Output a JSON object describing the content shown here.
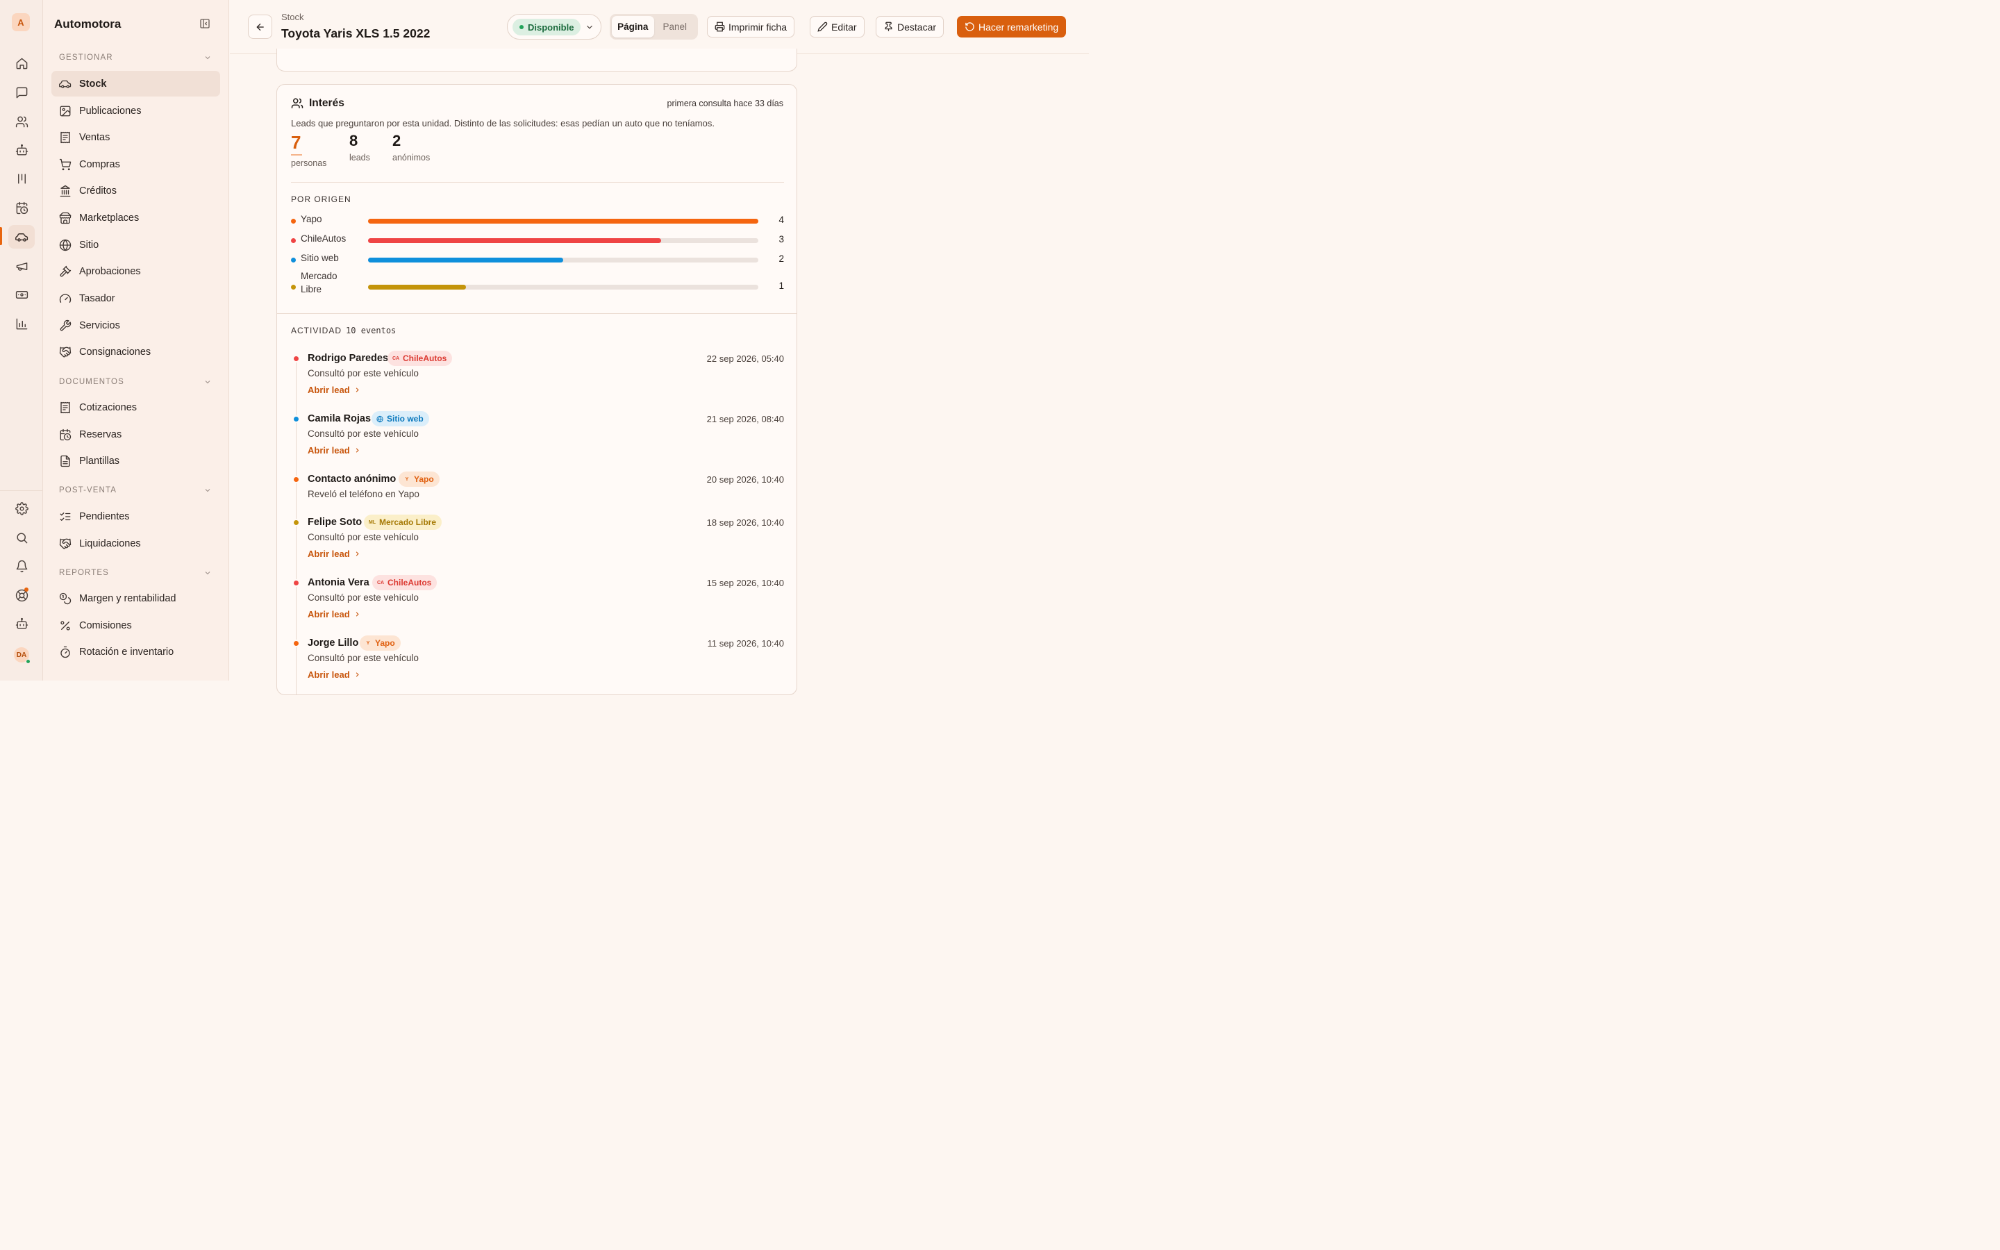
{
  "app": {
    "logo_letter": "A",
    "name": "Automotora",
    "user_initials": "DA"
  },
  "rail": {
    "top_icons": [
      "home-icon",
      "chat-icon",
      "users-icon",
      "bot-icon",
      "kanban-icon",
      "calendar-clock-icon",
      "car-icon",
      "megaphone-icon",
      "cash-icon",
      "bar-chart-icon"
    ],
    "bottom_icons": [
      "gear-icon",
      "search-icon",
      "bell-icon",
      "lifebuoy-icon",
      "bot-icon"
    ]
  },
  "sidebar": {
    "sections": [
      {
        "title": "GESTIONAR",
        "items": [
          {
            "label": "Stock",
            "icon": "car-icon",
            "active": true
          },
          {
            "label": "Publicaciones",
            "icon": "image-icon"
          },
          {
            "label": "Ventas",
            "icon": "receipt-icon"
          },
          {
            "label": "Compras",
            "icon": "cart-icon"
          },
          {
            "label": "Créditos",
            "icon": "bank-icon"
          },
          {
            "label": "Marketplaces",
            "icon": "store-icon"
          },
          {
            "label": "Sitio",
            "icon": "globe-icon"
          },
          {
            "label": "Aprobaciones",
            "icon": "gavel-icon"
          },
          {
            "label": "Tasador",
            "icon": "gauge-icon"
          },
          {
            "label": "Servicios",
            "icon": "wrench-icon"
          },
          {
            "label": "Consignaciones",
            "icon": "handshake-icon"
          }
        ]
      },
      {
        "title": "DOCUMENTOS",
        "items": [
          {
            "label": "Cotizaciones",
            "icon": "receipt-icon"
          },
          {
            "label": "Reservas",
            "icon": "calendar-clock-icon"
          },
          {
            "label": "Plantillas",
            "icon": "file-text-icon"
          }
        ]
      },
      {
        "title": "POST-VENTA",
        "items": [
          {
            "label": "Pendientes",
            "icon": "list-checks-icon"
          },
          {
            "label": "Liquidaciones",
            "icon": "handshake-icon"
          }
        ]
      },
      {
        "title": "REPORTES",
        "items": [
          {
            "label": "Margen y rentabilidad",
            "icon": "coins-icon"
          },
          {
            "label": "Comisiones",
            "icon": "percent-icon"
          },
          {
            "label": "Rotación e inventario",
            "icon": "timer-icon"
          }
        ]
      }
    ]
  },
  "header": {
    "breadcrumb": "Stock",
    "title": "Toyota Yaris XLS 1.5 2022",
    "status": "Disponible",
    "view_options": [
      "Página",
      "Panel"
    ],
    "view_selected": "Página",
    "buttons": {
      "print": "Imprimir ficha",
      "edit": "Editar",
      "feature": "Destacar",
      "remarketing": "Hacer remarketing"
    }
  },
  "interest": {
    "title": "Interés",
    "meta": "primera consulta hace 33 días",
    "description": "Leads que preguntaron por esta unidad. Distinto de las solicitudes: esas pedían un auto que no teníamos.",
    "stats": [
      {
        "value": "7",
        "label": "personas"
      },
      {
        "value": "8",
        "label": "leads"
      },
      {
        "value": "2",
        "label": "anónimos"
      }
    ],
    "origin_title": "POR ORIGEN",
    "origin_max": 4,
    "origins": [
      {
        "name": "Yapo",
        "count": 4,
        "color": "#f5650f"
      },
      {
        "name": "ChileAutos",
        "count": 3,
        "color": "#ef4444"
      },
      {
        "name": "Sitio web",
        "count": 2,
        "color": "#0f8fdb"
      },
      {
        "name": "Mercado Libre",
        "count": 1,
        "color": "#c4940a"
      }
    ],
    "activity_title": "ACTIVIDAD",
    "activity_count": "10 eventos",
    "events": [
      {
        "name": "Rodrigo Paredes",
        "source": "ChileAutos",
        "source_key": "chileautos",
        "date": "22 sep 2026, 05:40",
        "desc": "Consultó por este vehículo",
        "link": "Abrir lead"
      },
      {
        "name": "Camila Rojas",
        "source": "Sitio web",
        "source_key": "sitio",
        "date": "21 sep 2026, 08:40",
        "desc": "Consultó por este vehículo",
        "link": "Abrir lead"
      },
      {
        "name": "Contacto anónimo",
        "source": "Yapo",
        "source_key": "yapo",
        "date": "20 sep 2026, 10:40",
        "desc": "Reveló el teléfono en Yapo",
        "link": ""
      },
      {
        "name": "Felipe Soto",
        "source": "Mercado Libre",
        "source_key": "ml",
        "date": "18 sep 2026, 10:40",
        "desc": "Consultó por este vehículo",
        "link": "Abrir lead"
      },
      {
        "name": "Antonia Vera",
        "source": "ChileAutos",
        "source_key": "chileautos",
        "date": "15 sep 2026, 10:40",
        "desc": "Consultó por este vehículo",
        "link": "Abrir lead"
      },
      {
        "name": "Jorge Lillo",
        "source": "Yapo",
        "source_key": "yapo",
        "date": "11 sep 2026, 10:40",
        "desc": "Consultó por este vehículo",
        "link": "Abrir lead"
      }
    ]
  },
  "colors": {
    "accent": "#d95f0e",
    "success": "#22a35a"
  }
}
